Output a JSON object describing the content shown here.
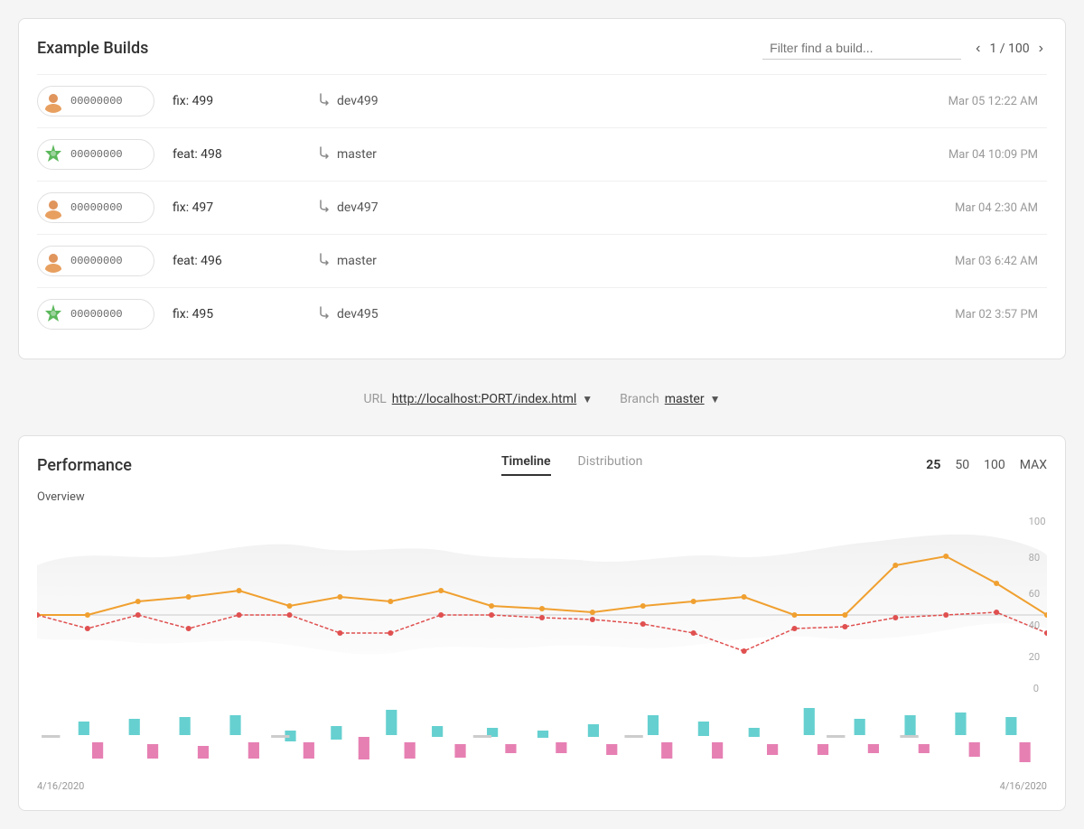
{
  "page": {
    "builds_card": {
      "title": "Example Builds",
      "filter_placeholder": "Filter find a build...",
      "pagination": {
        "current": 1,
        "total": 100,
        "display": "1 / 100"
      },
      "builds": [
        {
          "id": 1,
          "hash": "00000000",
          "description": "fix: 499",
          "branch": "dev499",
          "time": "Mar 05 12:22 AM",
          "avatar_type": "orange"
        },
        {
          "id": 2,
          "hash": "00000000",
          "description": "feat: 498",
          "branch": "master",
          "time": "Mar 04 10:09 PM",
          "avatar_type": "spiky"
        },
        {
          "id": 3,
          "hash": "00000000",
          "description": "fix: 497",
          "branch": "dev497",
          "time": "Mar 04 2:30 AM",
          "avatar_type": "orange"
        },
        {
          "id": 4,
          "hash": "00000000",
          "description": "feat: 496",
          "branch": "master",
          "time": "Mar 03 6:42 AM",
          "avatar_type": "orange"
        },
        {
          "id": 5,
          "hash": "00000000",
          "description": "fix: 495",
          "branch": "dev495",
          "time": "Mar 02 3:57 PM",
          "avatar_type": "spiky"
        }
      ]
    },
    "selectors": {
      "url_label": "URL",
      "url_value": "http://localhost:PORT/index.html",
      "branch_label": "Branch",
      "branch_value": "master"
    },
    "performance": {
      "title": "Performance",
      "tabs": [
        "Timeline",
        "Distribution"
      ],
      "active_tab": "Timeline",
      "controls": [
        "25",
        "50",
        "100",
        "MAX"
      ],
      "active_control": "25",
      "overview_label": "Overview",
      "y_axis": [
        "100",
        "80",
        "60",
        "40",
        "20",
        "0"
      ],
      "date_start": "4/16/2020",
      "date_end": "4/16/2020"
    }
  }
}
